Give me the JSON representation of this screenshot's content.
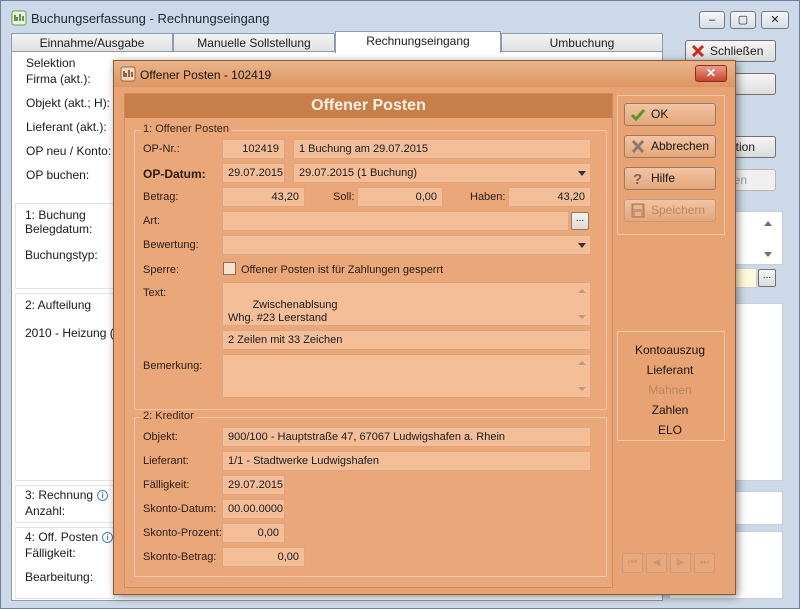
{
  "window": {
    "title": "Buchungserfassung - Rechnungseingang",
    "minimize": "‒",
    "maximize": "▢",
    "close": "✕"
  },
  "tabs": [
    "Einnahme/Ausgabe",
    "Manuelle Sollstellung",
    "Rechnungseingang",
    "Umbuchung"
  ],
  "selection": {
    "title": "Selektion",
    "labels": [
      "Firma (akt.):",
      "Objekt (akt.; H):",
      "Lieferant (akt.):",
      "OP neu / Konto:",
      "OP buchen:"
    ]
  },
  "sections": {
    "buchung": {
      "title": "1: Buchung",
      "labels": [
        "Belegdatum:",
        "Buchungstyp:"
      ]
    },
    "aufteilung": {
      "title": "2: Aufteilung",
      "row": "2010 - Heizung (Re"
    },
    "rechnung": {
      "title": "3: Rechnung",
      "labels": [
        "Anzahl:"
      ]
    },
    "offposten": {
      "title": "4: Off. Posten",
      "labels": [
        "Fälligkeit:",
        "Bearbeitung:"
      ]
    }
  },
  "right_buttons": {
    "close": "Schließen",
    "selection_fragment": "ktion",
    "disabled_fragment": "en",
    "ellipsis": "..."
  },
  "dialog": {
    "title": "Offener Posten - 102419",
    "close": "✕",
    "header": "Offener Posten",
    "group1": {
      "title": "1: Offener Posten",
      "op_nr_label": "OP-Nr.:",
      "op_nr": "102419",
      "op_nr_info": "1 Buchung am 29.07.2015",
      "op_datum_label": "OP-Datum:",
      "op_datum": "29.07.2015",
      "op_datum_select": "29.07.2015 (1 Buchung)",
      "betrag_label": "Betrag:",
      "betrag": "43,20",
      "soll_label": "Soll:",
      "soll": "0,00",
      "haben_label": "Haben:",
      "haben": "43,20",
      "art_label": "Art:",
      "art": "",
      "art_button": "...",
      "bewertung_label": "Bewertung:",
      "bewertung": "",
      "sperre_label": "Sperre:",
      "sperre_text": "Offener Posten ist für Zahlungen gesperrt",
      "text_label": "Text:",
      "text_value": "Zwischenablsung\nWhg. #23 Leerstand",
      "text_stats": "2 Zeilen mit 33 Zeichen",
      "bemerkung_label": "Bemerkung:",
      "bemerkung": ""
    },
    "group2": {
      "title": "2: Kreditor",
      "objekt_label": "Objekt:",
      "objekt": "900/100 - Hauptstraße 47, 67067 Ludwigshafen a. Rhein",
      "lieferant_label": "Lieferant:",
      "lieferant": "1/1 - Stadtwerke Ludwigshafen",
      "faelligkeit_label": "Fälligkeit:",
      "faelligkeit": "29.07.2015",
      "skonto_datum_label": "Skonto-Datum:",
      "skonto_datum": "00.00.0000",
      "skonto_prozent_label": "Skonto-Prozent:",
      "skonto_prozent": "0,00",
      "skonto_betrag_label": "Skonto-Betrag:",
      "skonto_betrag": "0,00"
    },
    "buttons": {
      "ok": "OK",
      "abbrechen": "Abbrechen",
      "hilfe": "Hilfe",
      "speichern": "Speichern"
    },
    "links": [
      "Kontoauszug",
      "Lieferant",
      "Mahnen",
      "Zahlen",
      "ELO"
    ],
    "nav": [
      "⏮",
      "◀",
      "▶",
      "⏭"
    ],
    "colors": {
      "dialog_bg": "#e8a374",
      "header_band": "#c77e48",
      "field_bg": "#f3be98"
    }
  }
}
